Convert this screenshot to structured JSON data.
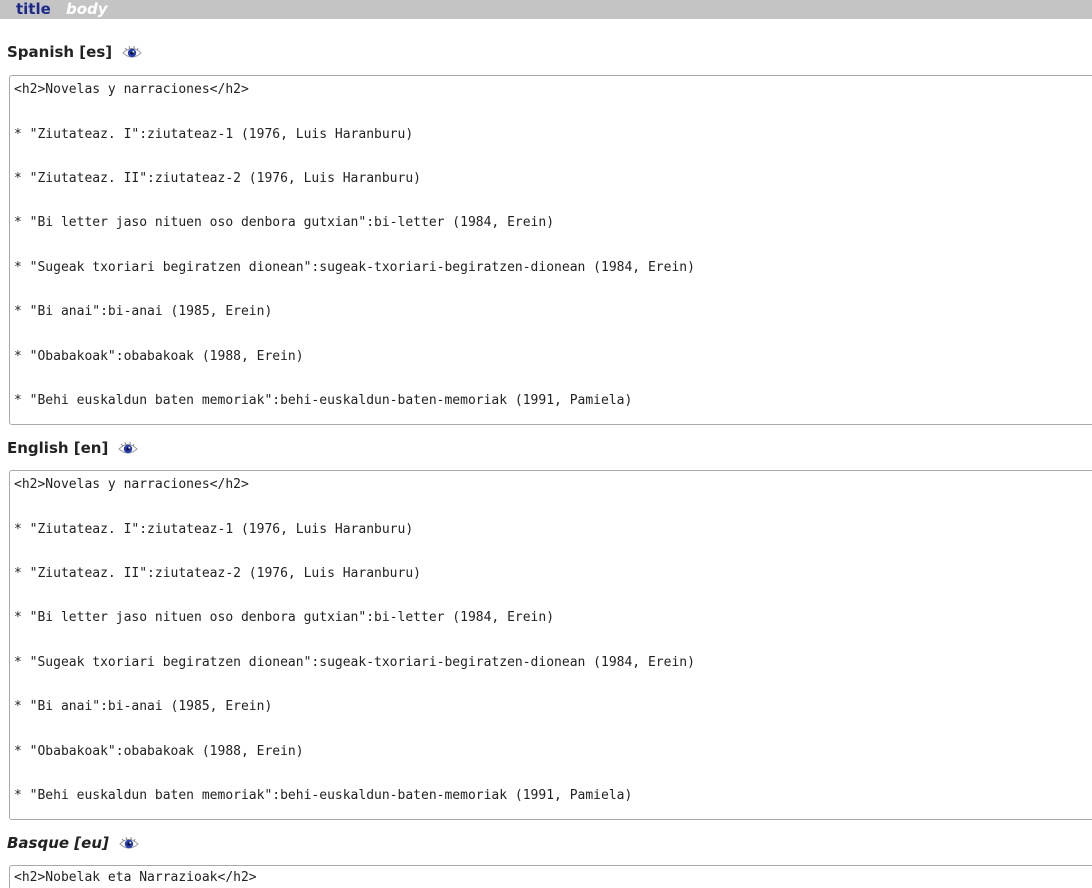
{
  "tabs": {
    "title": "title",
    "body": "body"
  },
  "sections": [
    {
      "heading": "Spanish [es]",
      "eye_icon": "eye-icon",
      "lines": [
        "<h2>Novelas y narraciones</h2>",
        "* \"Ziutateaz. I\":ziutateaz-1 (1976, Luis Haranburu)",
        "* \"Ziutateaz. II\":ziutateaz-2 (1976, Luis Haranburu)",
        "* \"Bi letter jaso nituen oso denbora gutxian\":bi-letter (1984, Erein)",
        "* \"Sugeak txoriari begiratzen dionean\":sugeak-txoriari-begiratzen-dionean (1984, Erein)",
        "* \"Bi anai\":bi-anai (1985, Erein)",
        "* \"Obabakoak\":obabakoak (1988, Erein)",
        "* \"Behi euskaldun baten memoriak\":behi-euskaldun-baten-memoriak (1991, Pamiela)"
      ]
    },
    {
      "heading": "English [en]",
      "eye_icon": "eye-icon",
      "lines": [
        "<h2>Novelas y narraciones</h2>",
        "* \"Ziutateaz. I\":ziutateaz-1 (1976, Luis Haranburu)",
        "* \"Ziutateaz. II\":ziutateaz-2 (1976, Luis Haranburu)",
        "* \"Bi letter jaso nituen oso denbora gutxian\":bi-letter (1984, Erein)",
        "* \"Sugeak txoriari begiratzen dionean\":sugeak-txoriari-begiratzen-dionean (1984, Erein)",
        "* \"Bi anai\":bi-anai (1985, Erein)",
        "* \"Obabakoak\":obabakoak (1988, Erein)",
        "* \"Behi euskaldun baten memoriak\":behi-euskaldun-baten-memoriak (1991, Pamiela)"
      ]
    },
    {
      "heading": "Basque [eu]",
      "eye_icon": "eye-icon",
      "lines": [
        "<h2>Nobelak eta Narrazioak</h2>"
      ]
    }
  ],
  "colors": {
    "tab_bar": "#c4c4c4",
    "tab_active": "#1c2b8a",
    "tab_inactive": "#ffffff",
    "box_border": "#a9a9a9",
    "text": "#222222",
    "eye_iris": "#2a3fb0"
  }
}
